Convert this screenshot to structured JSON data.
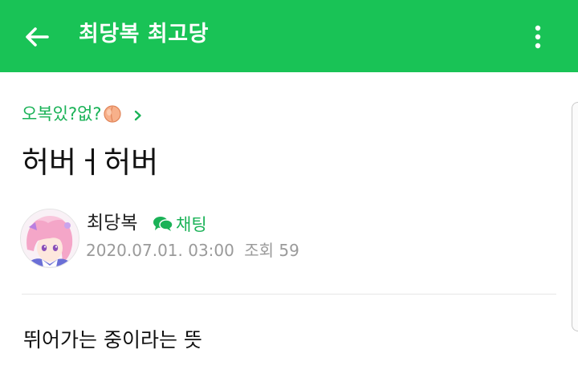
{
  "appbar": {
    "title": "최당복 최고당",
    "back_icon": "arrow-left-icon",
    "more_icon": "more-vertical-icon",
    "color": "#19c356"
  },
  "post": {
    "board_name": "오복있?없?",
    "board_emoji_icon": "peach-icon",
    "board_chevron_icon": "chevron-right-icon",
    "title": "허버ㅓ허버",
    "author": {
      "name": "최당복",
      "avatar_icon": "anime-avatar-icon"
    },
    "chat_label": "채팅",
    "chat_icon": "chat-bubbles-icon",
    "date": "2020.07.01. 03:00",
    "views_label": "조회 59",
    "body": "뛰어가는 중이라는 뜻"
  },
  "colors": {
    "accent": "#1ab257",
    "muted": "#9a9a9a"
  }
}
